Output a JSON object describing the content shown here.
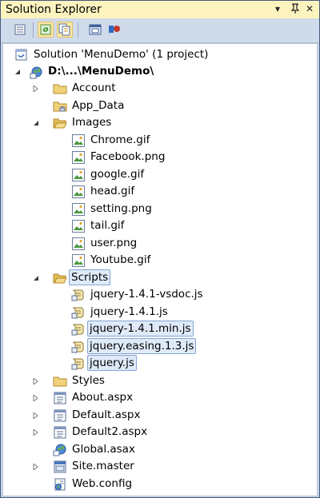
{
  "window": {
    "title": "Solution Explorer",
    "buttons": {
      "dropdown": "▾",
      "pin": "ᚨ",
      "close": "✕"
    }
  },
  "toolbar": {
    "tools": [
      {
        "name": "properties-tool-icon",
        "active": false
      },
      {
        "name": "refresh-tool-icon",
        "active": true
      },
      {
        "name": "show-all-files-tool-icon",
        "active": true
      },
      {
        "name": "view-designer-tool-icon",
        "active": false
      },
      {
        "name": "class-diagram-tool-icon",
        "active": false
      }
    ]
  },
  "tree": {
    "solution_label": "Solution 'MenuDemo' (1 project)",
    "project_label": "D:\\...\\MenuDemo\\",
    "account": "Account",
    "app_data": "App_Data",
    "images": "Images",
    "image_files": [
      "Chrome.gif",
      "Facebook.png",
      "google.gif",
      "head.gif",
      "setting.png",
      "tail.gif",
      "user.png",
      "Youtube.gif"
    ],
    "scripts": "Scripts",
    "script_files": [
      {
        "name": "jquery-1.4.1-vsdoc.js",
        "selected": false
      },
      {
        "name": "jquery-1.4.1.js",
        "selected": false
      },
      {
        "name": "jquery-1.4.1.min.js",
        "selected": true
      },
      {
        "name": "jquery.easing.1.3.js",
        "selected": true
      },
      {
        "name": "jquery.js",
        "selected": true
      }
    ],
    "styles": "Styles",
    "about": "About.aspx",
    "default": "Default.aspx",
    "default2": "Default2.aspx",
    "global": "Global.asax",
    "site_master": "Site.master",
    "web_config": "Web.config"
  },
  "colors": {
    "titlebar": "#fdf3bf",
    "toolbar": "#cfdaeb",
    "selection_bg": "#dfeaf8",
    "selection_border": "#86a4d3"
  }
}
